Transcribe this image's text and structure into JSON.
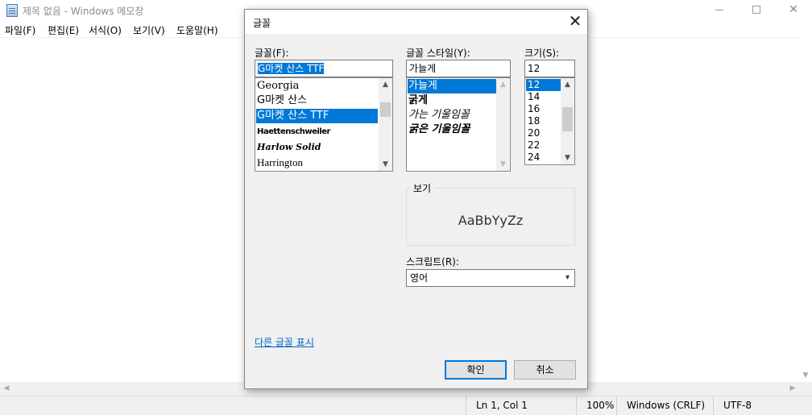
{
  "window": {
    "title": "제목 없음 - Windows 메모장",
    "minimize": "—",
    "close": "✕"
  },
  "menu": {
    "items": [
      "파일(F)",
      "편집(E)",
      "서식(O)",
      "보기(V)",
      "도움말(H)"
    ]
  },
  "statusbar": {
    "position": "Ln 1, Col 1",
    "zoom": "100%",
    "line_ending": "Windows (CRLF)",
    "encoding": "UTF-8"
  },
  "dialog": {
    "title": "글꼴",
    "close": "✕",
    "font": {
      "label": "글꼴(F):",
      "value": "G마켓 산스 TTF",
      "items": [
        "Georgia",
        "G마켓 산스",
        "G마켓 산스 TTF",
        "Haettenschweiler",
        "Harlow Solid",
        "Harrington"
      ]
    },
    "style": {
      "label": "글꼴 스타일(Y):",
      "value": "가늘게",
      "items": [
        "가늘게",
        "굵게",
        "가는 기울임꼴",
        "굵은 기울임꼴"
      ]
    },
    "size": {
      "label": "크기(S):",
      "value": "12",
      "items": [
        "12",
        "14",
        "16",
        "18",
        "20",
        "22",
        "24"
      ]
    },
    "sample": {
      "label": "보기",
      "text": "AaBbYyZz"
    },
    "script": {
      "label": "스크립트(R):",
      "value": "영어"
    },
    "more_fonts": "다른 글꼴 표시",
    "ok": "확인",
    "cancel": "취소"
  },
  "icons": {
    "scroll_up": "▲",
    "scroll_down": "▼",
    "scroll_left": "◀",
    "scroll_right": "▶",
    "dropdown": "▾"
  }
}
